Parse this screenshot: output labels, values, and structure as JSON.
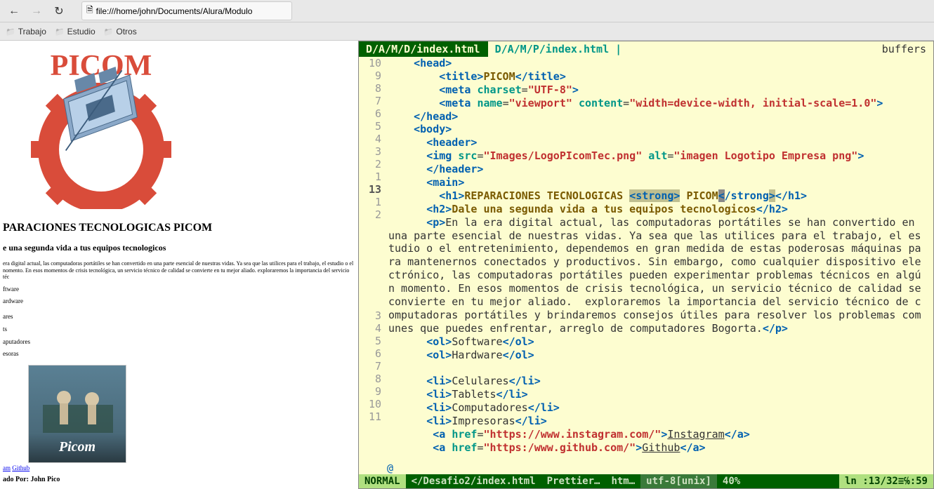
{
  "browser": {
    "url": "file:///home/john/Documents/Alura/Modulo",
    "nav": {
      "back": "←",
      "forward": "→",
      "reload": "↻"
    },
    "bookmarks": [
      {
        "label": "Trabajo"
      },
      {
        "label": "Estudio"
      },
      {
        "label": "Otros"
      }
    ]
  },
  "page": {
    "logo_brand": "PICOM",
    "h1": "PARACIONES TECNOLOGICAS PICOM",
    "h2": "e una segunda vida a tus equipos tecnologicos",
    "para": "era digital actual, las computadoras portátiles se han convertido en una parte esencial de nuestras vidas. Ya sea que las utilices para el trabajo, el estudio o el nomento. En esos momentos de crisis tecnológica, un servicio técnico de calidad se convierte en tu mejor aliado. exploraremos la importancia del servicio téc",
    "ol1": "ftware",
    "ol2": "ardware",
    "li1": "ares",
    "li2": "ts",
    "li3": "aputadores",
    "li4": "esoras",
    "card_label": "Picom",
    "link_instagram": "am",
    "link_github": "Github",
    "creator": "ado Por: John Pico"
  },
  "editor": {
    "tabs": {
      "active": "D/A/M/D/index.html",
      "inactive": "D/A/M/P/index.html |",
      "buffers_label": "buffers"
    },
    "gutter": [
      "10",
      "9",
      "8",
      "7",
      "6",
      "5",
      "4",
      "3",
      "2",
      "1",
      "13",
      "1",
      "2",
      "",
      "",
      "",
      "",
      "",
      "",
      "",
      "3",
      "4",
      "5",
      "6",
      "7",
      "8",
      "9",
      "10",
      "11",
      ""
    ],
    "code": {
      "l1": {
        "indent": "    ",
        "tag_open": "<head>",
        "tag_close": ""
      },
      "l2": {
        "indent": "        ",
        "tag": "title",
        "text": "PICOM"
      },
      "l3": {
        "indent": "        ",
        "tag": "meta",
        "attr1": "charset",
        "val1": "\"UTF-8\""
      },
      "l4": {
        "indent": "        ",
        "tag": "meta",
        "attr1": "name",
        "val1": "\"viewport\"",
        "attr2": "content",
        "val2": "\"width=device-width, initial-scale=1.0\""
      },
      "l5": {
        "indent": "    ",
        "tag": "/head"
      },
      "l6": {
        "indent": "    ",
        "tag": "body"
      },
      "l7": {
        "indent": "      ",
        "tag": "header"
      },
      "l8": {
        "indent": "      ",
        "tag": "img",
        "attr1": "src",
        "val1": "\"Images/LogoPIcomTec.png\"",
        "attr2": "alt",
        "val2": "\"imagen Logotipo Empresa png\""
      },
      "l9": {
        "indent": "      ",
        "tag": "/header"
      },
      "l10": {
        "indent": "      ",
        "tag": "main"
      },
      "l11": {
        "indent": "        ",
        "tag": "h1",
        "text1": "REPARACIONES TECNOLOGICAS ",
        "strong": "strong",
        "text2": " PICOM"
      },
      "l12": {
        "indent": "      ",
        "tag": "h2",
        "text": "Dale una segunda vida a tus equipos tecnologicos"
      },
      "l13": {
        "indent": "      ",
        "tag": "p",
        "text": "En la era digital actual, las computadoras portátiles se han convertido en una parte esencial de nuestras vidas. Ya sea que las utilices para el trabajo, el estudio o el entretenimiento, dependemos en gran medida de estas poderosas máquinas para mantenernos conectados y productivos. Sin embargo, como cualquier dispositivo electrónico, las computadoras portátiles pueden experimentar problemas técnicos en algún momento. En esos momentos de crisis tecnológica, un servicio técnico de calidad se convierte en tu mejor aliado.  exploraremos la importancia del servicio técnico de computadoras portátiles y brindaremos consejos útiles para resolver los problemas comunes que puedes enfrentar, arreglo de computadores Bogorta."
      },
      "l14": {
        "indent": "      ",
        "tag": "ol",
        "text": "Software"
      },
      "l15": {
        "indent": "      ",
        "tag": "ol",
        "text": "Hardware"
      },
      "l16": "",
      "l17": {
        "indent": "      ",
        "tag": "li",
        "text": "Celulares"
      },
      "l18": {
        "indent": "      ",
        "tag": "li",
        "text": "Tablets"
      },
      "l19": {
        "indent": "      ",
        "tag": "li",
        "text": "Computadores"
      },
      "l20": {
        "indent": "      ",
        "tag": "li",
        "text": "Impresoras"
      },
      "l21": {
        "indent": "       ",
        "tag": "a",
        "attr": "href",
        "val": "\"https://www.instagram.com/\"",
        "text": "Instagram"
      },
      "l22": {
        "indent": "       ",
        "tag": "a",
        "attr": "href",
        "val": "\"https:/www.github.com/\"",
        "text": "Github"
      },
      "end": "@"
    },
    "status": {
      "mode": "NORMAL",
      "path": "</Desafio2/index.html",
      "prettier": "Prettier…",
      "filetype": "htm…",
      "encoding": "utf-8[unix]",
      "percent": "40%",
      "position": "ln :13/32≡℅:59"
    }
  }
}
